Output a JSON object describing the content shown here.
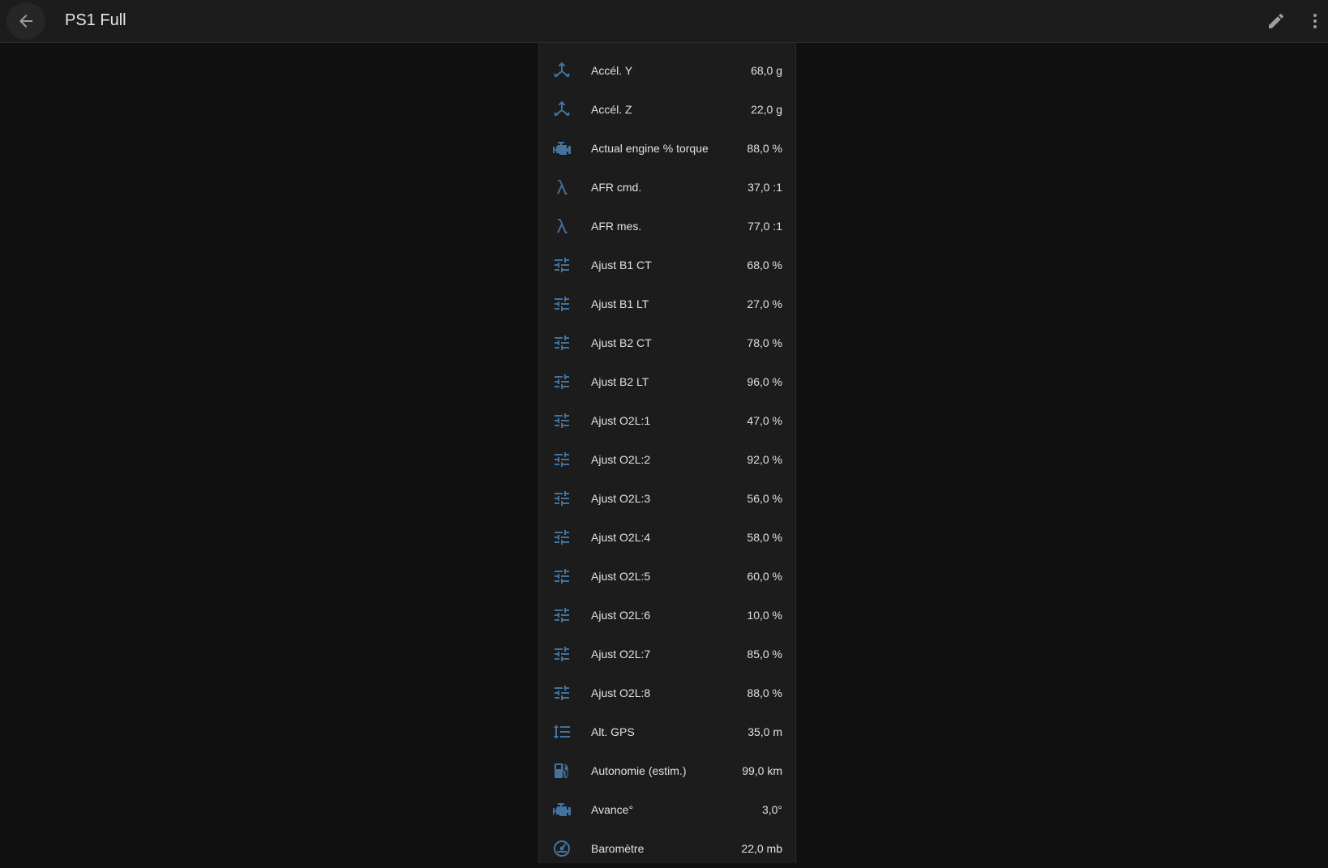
{
  "header": {
    "title": "PS1 Full",
    "back_icon": "arrow-left-icon",
    "edit_icon": "pencil-icon",
    "more_icon": "dots-vertical-icon"
  },
  "colors": {
    "accent_icon": "#44739e",
    "background": "#111111",
    "card": "#1c1c1c",
    "toolbar": "#1c1c1c"
  },
  "entities": [
    {
      "icon": "axis-arrow-icon",
      "name": "Accél. Y",
      "value": "68,0 g"
    },
    {
      "icon": "axis-arrow-icon",
      "name": "Accél. Z",
      "value": "22,0 g"
    },
    {
      "icon": "engine-icon",
      "name": "Actual engine % torque",
      "value": "88,0 %"
    },
    {
      "icon": "lambda-icon",
      "name": "AFR cmd.",
      "value": "37,0 :1"
    },
    {
      "icon": "lambda-icon",
      "name": "AFR mes.",
      "value": "77,0 :1"
    },
    {
      "icon": "tune-icon",
      "name": "Ajust B1 CT",
      "value": "68,0 %"
    },
    {
      "icon": "tune-icon",
      "name": "Ajust B1 LT",
      "value": "27,0 %"
    },
    {
      "icon": "tune-icon",
      "name": "Ajust B2 CT",
      "value": "78,0 %"
    },
    {
      "icon": "tune-icon",
      "name": "Ajust B2 LT",
      "value": "96,0 %"
    },
    {
      "icon": "tune-icon",
      "name": "Ajust O2L:1",
      "value": "47,0 %"
    },
    {
      "icon": "tune-icon",
      "name": "Ajust O2L:2",
      "value": "92,0 %"
    },
    {
      "icon": "tune-icon",
      "name": "Ajust O2L:3",
      "value": "56,0 %"
    },
    {
      "icon": "tune-icon",
      "name": "Ajust O2L:4",
      "value": "58,0 %"
    },
    {
      "icon": "tune-icon",
      "name": "Ajust O2L:5",
      "value": "60,0 %"
    },
    {
      "icon": "tune-icon",
      "name": "Ajust O2L:6",
      "value": "10,0 %"
    },
    {
      "icon": "tune-icon",
      "name": "Ajust O2L:7",
      "value": "85,0 %"
    },
    {
      "icon": "tune-icon",
      "name": "Ajust O2L:8",
      "value": "88,0 %"
    },
    {
      "icon": "format-line-spacing-icon",
      "name": "Alt. GPS",
      "value": "35,0 m"
    },
    {
      "icon": "gas-station-icon",
      "name": "Autonomie (estim.)",
      "value": "99,0 km"
    },
    {
      "icon": "engine-icon",
      "name": "Avance°",
      "value": "3,0°"
    },
    {
      "icon": "gauge-icon",
      "name": "Baromètre",
      "value": "22,0 mb"
    }
  ]
}
